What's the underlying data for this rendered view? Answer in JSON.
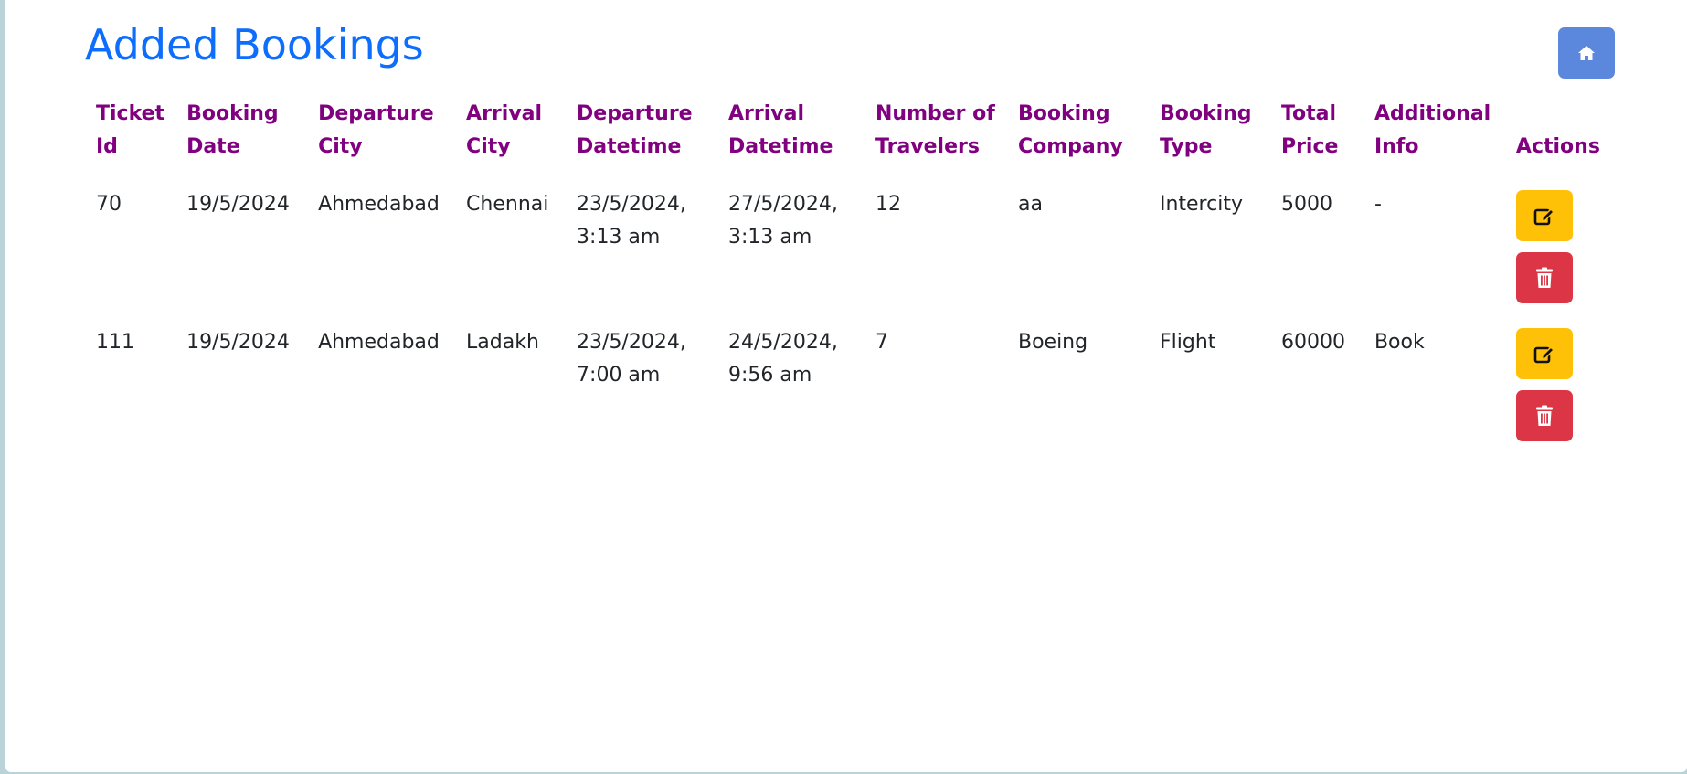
{
  "page": {
    "title": "Added Bookings"
  },
  "header_buttons": {
    "home_icon": "home-icon"
  },
  "table": {
    "columns": [
      "Ticket Id",
      "Booking Date",
      "Departure City",
      "Arrival City",
      "Departure Datetime",
      "Arrival Datetime",
      "Number of Travelers",
      "Booking Company",
      "Booking Type",
      "Total Price",
      "Additional Info",
      "Actions"
    ],
    "rows": [
      {
        "ticket_id": "70",
        "booking_date": "19/5/2024",
        "departure_city": "Ahmedabad",
        "arrival_city": "Chennai",
        "departure_datetime": "23/5/2024, 3:13 am",
        "arrival_datetime": "27/5/2024, 3:13 am",
        "travelers": "12",
        "company": "aa",
        "type": "Intercity",
        "total_price": "5000",
        "additional_info": "-"
      },
      {
        "ticket_id": "111",
        "booking_date": "19/5/2024",
        "departure_city": "Ahmedabad",
        "arrival_city": "Ladakh",
        "departure_datetime": "23/5/2024, 7:00 am",
        "arrival_datetime": "24/5/2024, 9:56 am",
        "travelers": "7",
        "company": "Boeing",
        "type": "Flight",
        "total_price": "60000",
        "additional_info": "Book"
      }
    ],
    "action_icons": {
      "edit": "edit-icon",
      "delete": "trash-icon"
    }
  },
  "colors": {
    "title": "#0d6efd",
    "header_text": "#800080",
    "home_button": "#5b87dd",
    "edit_button": "#ffc107",
    "delete_button": "#dc3545"
  }
}
